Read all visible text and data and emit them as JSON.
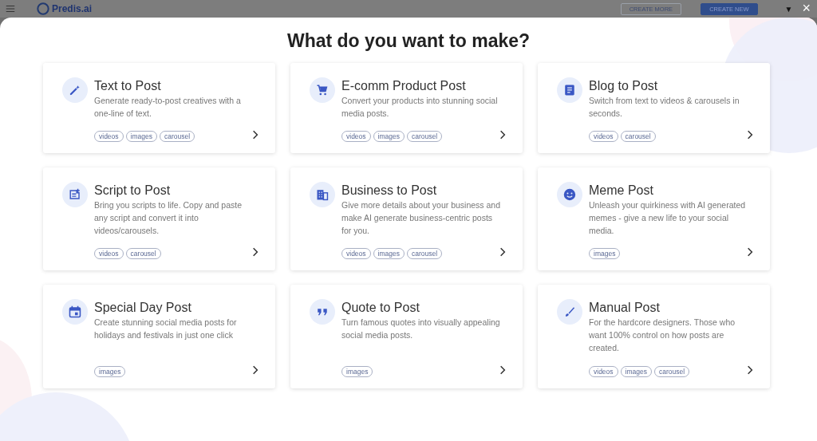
{
  "header": {
    "logo_text": "Predis.ai",
    "buttons": [
      {
        "label": "CREATE MORE",
        "kind": "outline"
      },
      {
        "label": "CREATE NEW",
        "kind": "filled"
      }
    ],
    "caret": "▼",
    "close": "×"
  },
  "dialog": {
    "title": "What do you want to make?",
    "cards": [
      {
        "title": "Text to Post",
        "description": "Generate ready-to-post creatives with a one-line of text.",
        "tags": [
          "videos",
          "images",
          "carousel"
        ]
      },
      {
        "title": "E-comm Product Post",
        "description": "Convert your products into stunning social media posts.",
        "tags": [
          "videos",
          "images",
          "carousel"
        ]
      },
      {
        "title": "Blog to Post",
        "description": "Switch from text to videos & carousels in seconds.",
        "tags": [
          "videos",
          "carousel"
        ]
      },
      {
        "title": "Script to Post",
        "description": "Bring you scripts to life. Copy and paste any script and convert it into videos/carousels.",
        "tags": [
          "videos",
          "carousel"
        ]
      },
      {
        "title": "Business to Post",
        "description": "Give more details about your business and make AI generate business-centric posts for you.",
        "tags": [
          "videos",
          "images",
          "carousel"
        ]
      },
      {
        "title": "Meme Post",
        "description": "Unleash your quirkiness with AI generated memes - give a new life to your social media.",
        "tags": [
          "images"
        ]
      },
      {
        "title": "Special Day Post",
        "description": "Create stunning social media posts for holidays and festivals in just one click",
        "tags": [
          "images"
        ]
      },
      {
        "title": "Quote to Post",
        "description": "Turn famous quotes into visually appealing social media posts.",
        "tags": [
          "images"
        ]
      },
      {
        "title": "Manual Post",
        "description": "For the hardcore designers. Those who want 100% control on how posts are created.",
        "tags": [
          "videos",
          "images",
          "carousel"
        ]
      }
    ]
  }
}
